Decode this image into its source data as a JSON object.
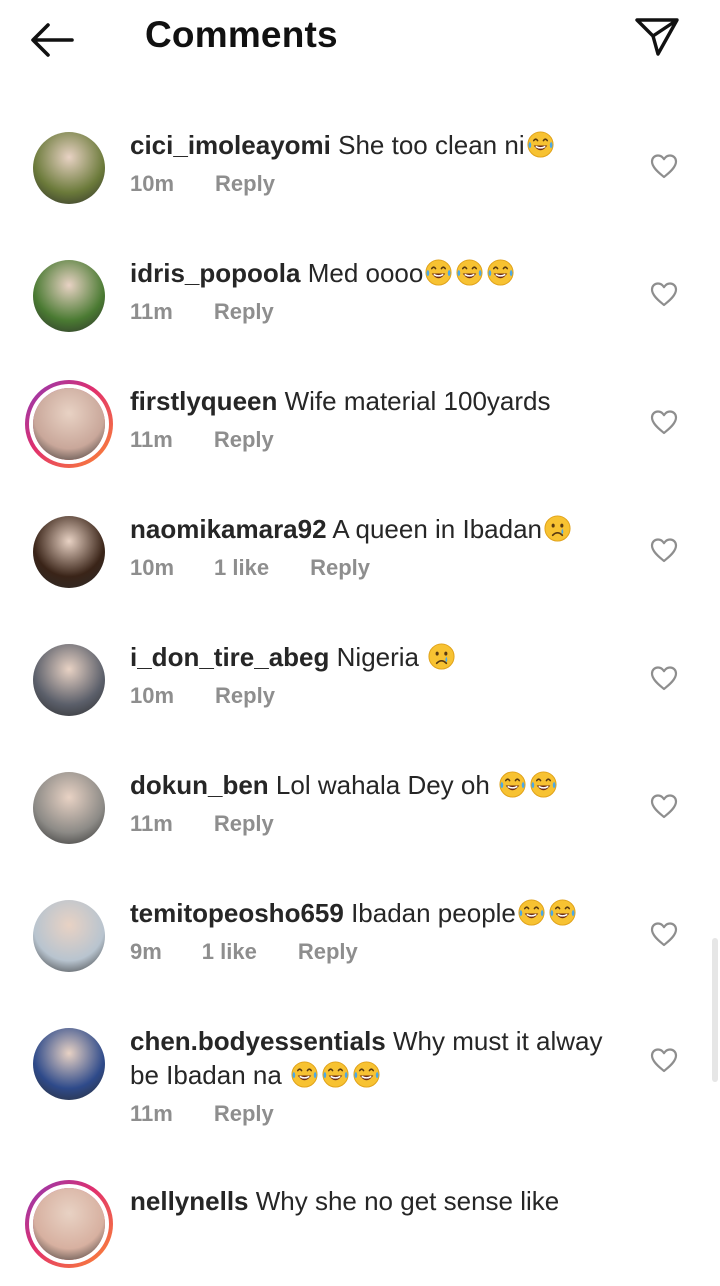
{
  "header": {
    "title": "Comments",
    "back_icon": "arrow-left-icon",
    "share_icon": "paper-plane-icon"
  },
  "comments": [
    {
      "username": "cici_imoleayomi",
      "text": "She too clean ni",
      "emojis": [
        "laugh-cry"
      ],
      "time": "10m",
      "likes": "",
      "reply": "Reply",
      "avatar_bg": "#6b7a3a",
      "story_ring": false
    },
    {
      "username": "idris_popoola",
      "text": "Med oooo",
      "emojis": [
        "laugh-cry",
        "laugh-cry",
        "laugh-cry"
      ],
      "time": "11m",
      "likes": "",
      "reply": "Reply",
      "avatar_bg": "#4a7a32",
      "story_ring": false
    },
    {
      "username": "firstlyqueen",
      "text": "Wife material  100yards",
      "emojis": [],
      "time": "11m",
      "likes": "",
      "reply": "Reply",
      "avatar_bg": "#c9a79a",
      "story_ring": true
    },
    {
      "username": "naomikamara92",
      "text": "A queen in Ibadan",
      "emojis": [
        "crying"
      ],
      "time": "10m",
      "likes": "1 like",
      "reply": "Reply",
      "avatar_bg": "#3a2418",
      "story_ring": false
    },
    {
      "username": "i_don_tire_abeg",
      "text": "Nigeria ",
      "emojis": [
        "crying"
      ],
      "time": "10m",
      "likes": "",
      "reply": "Reply",
      "avatar_bg": "#5b5f6a",
      "story_ring": false
    },
    {
      "username": "dokun_ben",
      "text": "Lol wahala Dey oh ",
      "emojis": [
        "laugh-cry",
        "laugh-cry"
      ],
      "time": "11m",
      "likes": "",
      "reply": "Reply",
      "avatar_bg": "#8c8a86",
      "story_ring": false
    },
    {
      "username": "temitopeosho659",
      "text": "Ibadan people",
      "emojis": [
        "laugh-cry",
        "laugh-cry"
      ],
      "time": "9m",
      "likes": "1 like",
      "reply": "Reply",
      "avatar_bg": "#b8c4cf",
      "story_ring": false
    },
    {
      "username": "chen.bodyessentials",
      "text": "Why must it alway be Ibadan na ",
      "emojis": [
        "laugh-cry",
        "laugh-cry",
        "laugh-cry"
      ],
      "time": "11m",
      "likes": "",
      "reply": "Reply",
      "avatar_bg": "#2e4a8a",
      "story_ring": false
    },
    {
      "username": "nellynells",
      "text": "Why she no get sense like",
      "emojis": [],
      "time": "",
      "likes": "",
      "reply": "",
      "avatar_bg": "#d7b0a0",
      "story_ring": true
    }
  ],
  "colors": {
    "text": "#262626",
    "meta": "#8e8e8e",
    "ring_start": "#8a3ab9",
    "ring_end": "#fd8d32"
  }
}
